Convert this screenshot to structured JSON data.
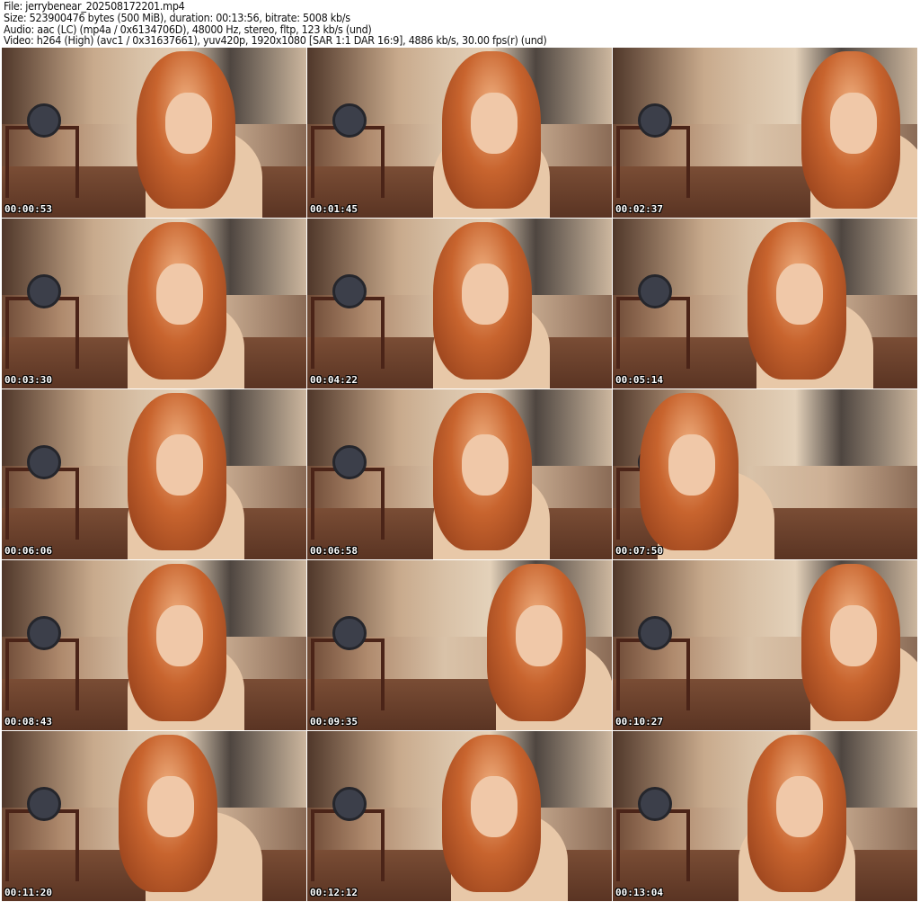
{
  "header": {
    "file": "File: jerrybenear_202508172201.mp4",
    "size": "Size: 523900476 bytes (500 MiB), duration: 00:13:56, bitrate: 5008 kb/s",
    "audio": "Audio: aac (LC) (mp4a / 0x6134706D), 48000 Hz, stereo, fltp, 123 kb/s (und)",
    "video": "Video: h264 (High) (avc1 / 0x31637661), yuv420p, 1920x1080 [SAR 1:1 DAR 16:9], 4886 kb/s, 30.00 fps(r) (und)"
  },
  "thumbnails": [
    {
      "timestamp": "00:00:53"
    },
    {
      "timestamp": "00:01:45"
    },
    {
      "timestamp": "00:02:37"
    },
    {
      "timestamp": "00:03:30"
    },
    {
      "timestamp": "00:04:22"
    },
    {
      "timestamp": "00:05:14"
    },
    {
      "timestamp": "00:06:06"
    },
    {
      "timestamp": "00:06:58"
    },
    {
      "timestamp": "00:07:50"
    },
    {
      "timestamp": "00:08:43"
    },
    {
      "timestamp": "00:09:35"
    },
    {
      "timestamp": "00:10:27"
    },
    {
      "timestamp": "00:11:20"
    },
    {
      "timestamp": "00:12:12"
    },
    {
      "timestamp": "00:13:04"
    }
  ]
}
